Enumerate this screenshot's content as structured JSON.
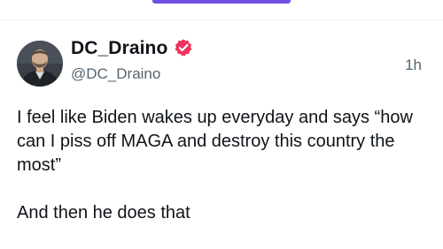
{
  "theme": {
    "accent": "#6f4fe6",
    "verified_badge": "#f0325c"
  },
  "post": {
    "author": {
      "display_name": "DC_Draino",
      "handle": "@DC_Draino",
      "avatar_icon": "avatar-photo",
      "verified_icon": "verified-badge-icon"
    },
    "timestamp": "1h",
    "text": "I feel like Biden wakes up everyday and says “how can I piss off MAGA and destroy this country the most”\n\nAnd then he does that"
  }
}
